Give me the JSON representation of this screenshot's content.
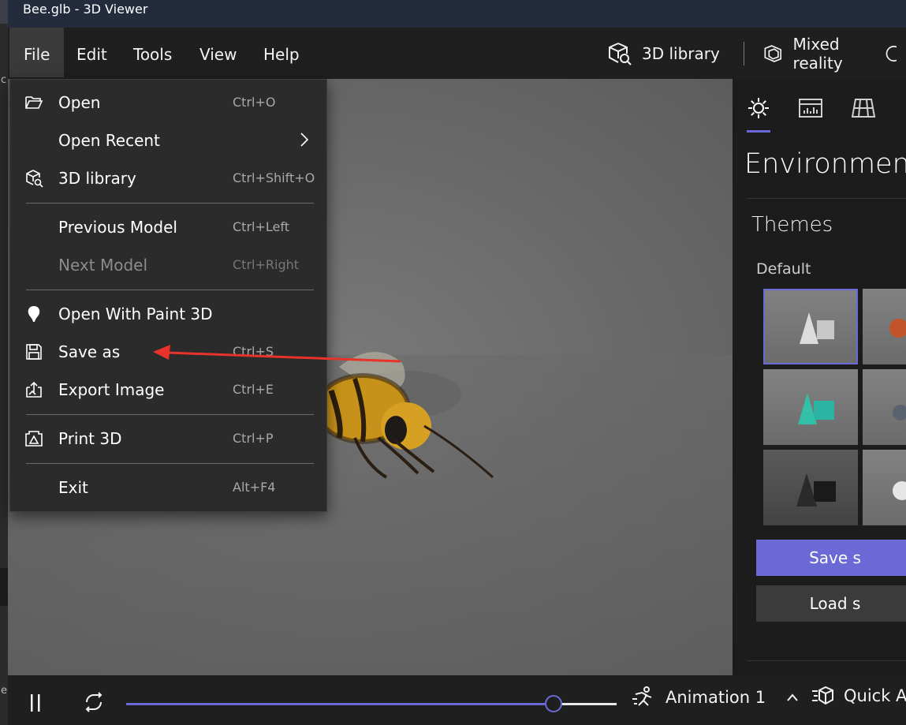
{
  "window": {
    "title": "Bee.glb - 3D Viewer"
  },
  "background_window": {
    "fragments": [
      "c",
      "e"
    ]
  },
  "menubar": {
    "items": [
      {
        "label": "File",
        "active": true
      },
      {
        "label": "Edit"
      },
      {
        "label": "Tools"
      },
      {
        "label": "View"
      },
      {
        "label": "Help"
      }
    ],
    "library_label": "3D library",
    "mixed_reality_label": "Mixed reality"
  },
  "file_menu": {
    "open": {
      "label": "Open",
      "shortcut": "Ctrl+O",
      "icon": "folder-open-icon"
    },
    "open_recent": {
      "label": "Open Recent",
      "icon": "chevron-right-icon"
    },
    "library": {
      "label": "3D library",
      "shortcut": "Ctrl+Shift+O",
      "icon": "cube-search-icon"
    },
    "previous_model": {
      "label": "Previous Model",
      "shortcut": "Ctrl+Left"
    },
    "next_model": {
      "label": "Next Model",
      "shortcut": "Ctrl+Right",
      "disabled": true
    },
    "open_paint3d": {
      "label": "Open With Paint 3D",
      "icon": "paint-drop-icon"
    },
    "save_as": {
      "label": "Save as",
      "shortcut": "Ctrl+S",
      "icon": "save-icon"
    },
    "export_image": {
      "label": "Export Image",
      "shortcut": "Ctrl+E",
      "icon": "export-icon"
    },
    "print_3d": {
      "label": "Print 3D",
      "shortcut": "Ctrl+P",
      "icon": "print-3d-icon"
    },
    "exit": {
      "label": "Exit",
      "shortcut": "Alt+F4"
    }
  },
  "side_panel": {
    "tabs": [
      "lighting-icon",
      "stats-icon",
      "grid-icon"
    ],
    "heading": "Environment",
    "themes_label": "Themes",
    "default_label": "Default",
    "primary_button": "Save s",
    "secondary_button": "Load s"
  },
  "bottombar": {
    "animation_progress": 0.87,
    "animation_label": "Animation 1",
    "quick_label": "Quick An"
  },
  "colors": {
    "accent": "#6b69d6",
    "annotation_arrow": "#e8332a"
  }
}
